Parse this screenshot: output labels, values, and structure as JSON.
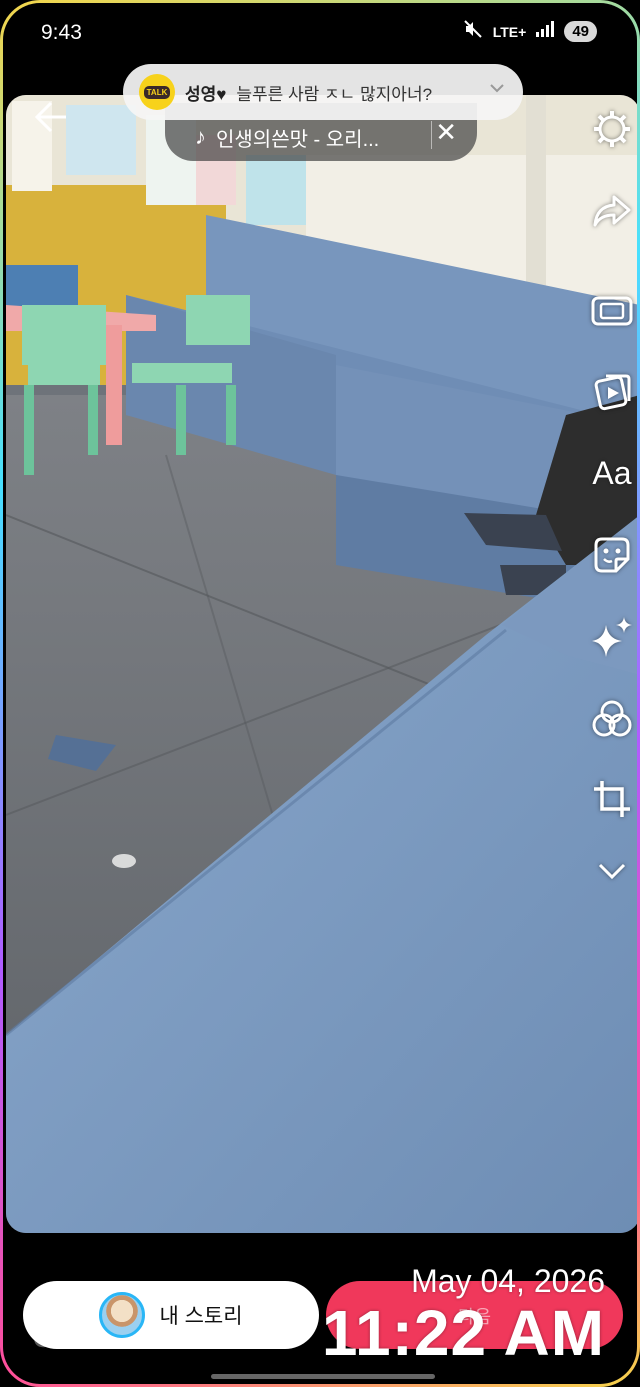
{
  "status": {
    "time": "9:43",
    "network": "LTE+",
    "battery": "49",
    "icons": [
      "mute-icon",
      "signal-icon"
    ]
  },
  "notification": {
    "app_icon": "kakaotalk-icon",
    "app_icon_text": "TALK",
    "sender": "성영♥",
    "message": "늘푸른 사람 ㅈㄴ 많지아너?"
  },
  "music": {
    "title": "인생의쓴맛 - 오리..."
  },
  "toolbar": {
    "text_tool_label": "Aa",
    "icons": [
      "settings-icon",
      "share-arrow-icon",
      "resize-icon",
      "media-icon",
      "text-icon",
      "sticker-icon",
      "effects-sparkle-icon",
      "filter-icon",
      "crop-icon",
      "chevron-down-icon"
    ]
  },
  "bottom": {
    "story_label": "내 스토리",
    "share_label": "다음",
    "behind_text": "Cashaos",
    "date_sticker": "May 04, 2026",
    "time_sticker": "11:22 AM"
  },
  "colors": {
    "share_button": "#f0385b",
    "sofa": "#7d9cc2",
    "notification_bg": "#f5f5f5"
  }
}
